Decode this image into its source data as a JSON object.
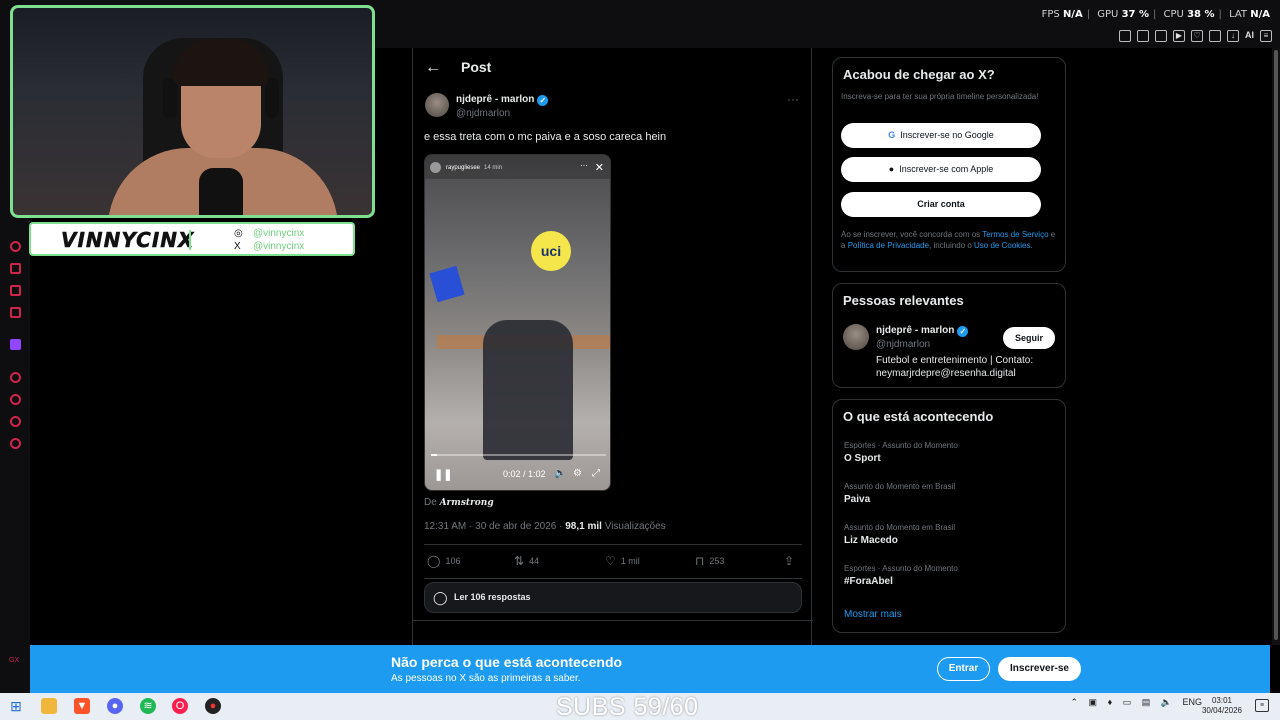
{
  "hud": {
    "fps_label": "FPS",
    "fps": "N/A",
    "gpu_label": "GPU",
    "gpu": "37 %",
    "cpu_label": "CPU",
    "cpu": "38 %",
    "lat_label": "LAT",
    "lat": "N/A"
  },
  "toolbar": {
    "ai_label": "AI"
  },
  "stream": {
    "channel_name": "VINNYCINX",
    "instagram": "@vinnycinx",
    "twitter": "@vinnycinx"
  },
  "sidebar": {
    "bottom_label": "GX"
  },
  "post": {
    "header_title": "Post",
    "author_name": "njdeprê - marlon",
    "author_handle": "@njdmarlon",
    "text": "e essa treta com o mc paiva e a soso careca hein",
    "video": {
      "uploader": "raypugliesee",
      "uploaded_ago": "14 min",
      "logo_text": "uci",
      "time": "0:02 / 1:02",
      "progress": 0.032
    },
    "source_prefix": "De",
    "source_name": "Armstrong",
    "timestamp": "12:31 AM · 30 de abr de 2026 ·",
    "views_count": "98,1 mil",
    "views_label": "Visualizações",
    "stats": {
      "replies": "106",
      "reposts": "44",
      "likes": "1 mil",
      "bookmarks": "253"
    },
    "read_replies": "Ler 106 respostas"
  },
  "signup": {
    "title": "Acabou de chegar ao X?",
    "subtitle": "Inscreva-se para ter sua própria timeline personalizada!",
    "google_label": "Inscrever-se no Google",
    "apple_label": "Inscrever-se com Apple",
    "create_label": "Criar conta",
    "legal_prefix": "Ao se inscrever, você concorda com os",
    "terms": "Termos de Serviço",
    "legal_and": "e a",
    "privacy": "Política de Privacidade",
    "legal_including": ", incluindo o",
    "cookies": "Uso de Cookies."
  },
  "people": {
    "title": "Pessoas relevantes",
    "name": "njdeprê - marlon",
    "handle": "@njdmarlon",
    "follow_label": "Seguir",
    "bio": "Futebol e entretenimento | Contato: neymarjrdepre@resenha.digital"
  },
  "trends": {
    "title": "O que está acontecendo",
    "items": [
      {
        "category": "Esportes · Assunto do Momento",
        "name": "O Sport"
      },
      {
        "category": "Assunto do Momento em Brasil",
        "name": "Paiva"
      },
      {
        "category": "Assunto do Momento em Brasil",
        "name": "Liz Macedo"
      },
      {
        "category": "Esportes · Assunto do Momento",
        "name": "#ForaAbel"
      }
    ],
    "show_more": "Mostrar mais"
  },
  "banner": {
    "headline": "Não perca o que está acontecendo",
    "subline": "As pessoas no X são as primeiras a saber.",
    "login_label": "Entrar",
    "register_label": "Inscrever-se"
  },
  "overlay": {
    "subs": "SUBS 59/60"
  },
  "taskbar": {
    "lang": "ENG",
    "time": "03:01",
    "date": "30/04/2026"
  },
  "colors": {
    "accent": "#1d9bf0",
    "cam_border": "#7ee08e",
    "sidebar_icons": "#d0254a"
  }
}
